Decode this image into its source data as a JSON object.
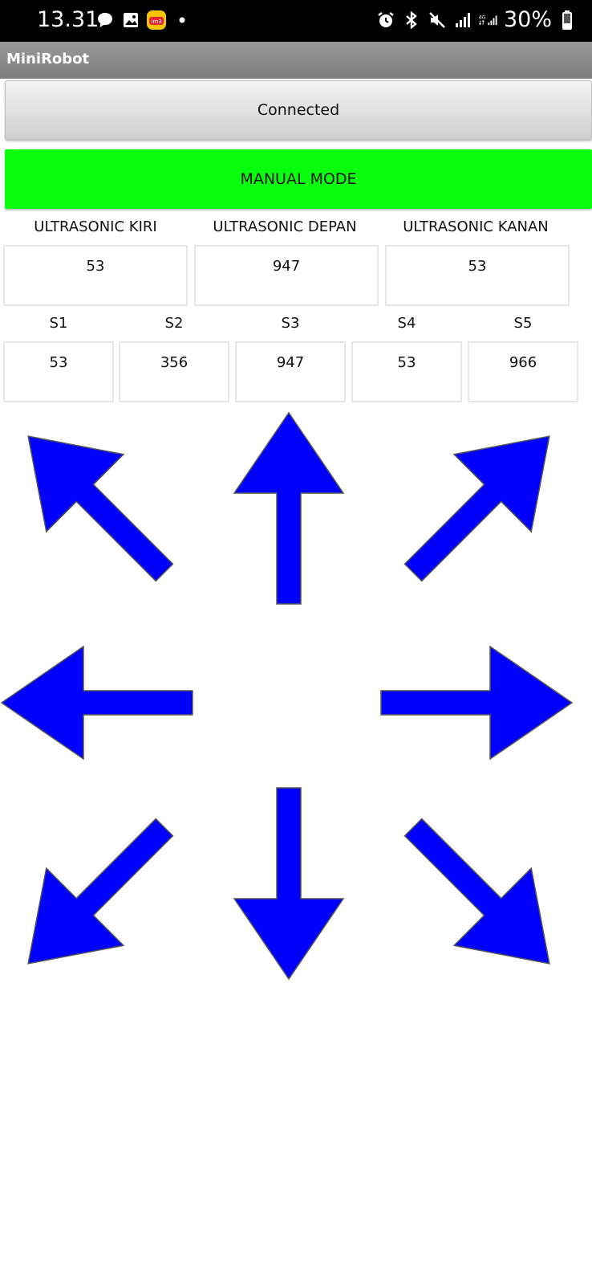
{
  "status_bar": {
    "time": "13.31",
    "left_icons": [
      "chat-bubble-icon",
      "gallery-icon",
      "myim3-app-icon",
      "dot-icon"
    ],
    "right_icons": [
      "alarm-icon",
      "bluetooth-icon",
      "mute-icon",
      "signal-icon",
      "4g-signal-icon",
      "battery-icon"
    ],
    "network": "4G",
    "battery_percent": "30%"
  },
  "app": {
    "title": "MiniRobot"
  },
  "buttons": {
    "connection": "Connected",
    "mode": "MANUAL MODE",
    "mode_color": "#08ff0e"
  },
  "ultrasonic": [
    {
      "label": "ULTRASONIC KIRI",
      "value": "53"
    },
    {
      "label": "ULTRASONIC DEPAN",
      "value": "947"
    },
    {
      "label": "ULTRASONIC KANAN",
      "value": "53"
    }
  ],
  "sensors": [
    {
      "label": "S1",
      "value": "53"
    },
    {
      "label": "S2",
      "value": "356"
    },
    {
      "label": "S3",
      "value": "947"
    },
    {
      "label": "S4",
      "value": "53"
    },
    {
      "label": "S5",
      "value": "966"
    }
  ],
  "arrows": {
    "color": "#0000ff",
    "directions": [
      "up-left",
      "up",
      "up-right",
      "left",
      "right",
      "down-left",
      "down",
      "down-right"
    ]
  }
}
